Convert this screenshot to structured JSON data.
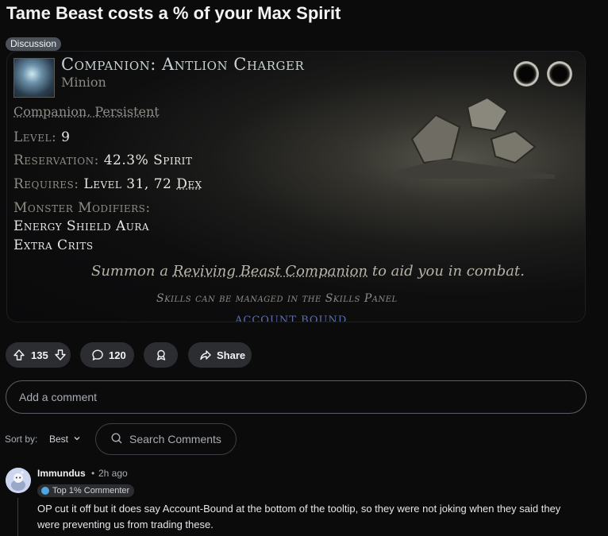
{
  "post": {
    "title": "Tame Beast costs a % of your Max Spirit",
    "flair": "Discussion"
  },
  "tooltip": {
    "name": "Companion: Antlion Charger",
    "type": "Minion",
    "tags": "Companion, Persistent",
    "level_label": "Level:",
    "level_value": "9",
    "reservation_label": "Reservation:",
    "reservation_value": "42.3% Spirit",
    "requires_label": "Requires:",
    "requires_value": "Level 31, 72",
    "requires_attr": "Dex",
    "modifiers_label": "Monster Modifiers:",
    "modifier_1": "Energy Shield Aura",
    "modifier_2": "Extra Crits",
    "desc_1": "Summon a",
    "desc_2": "Reviving Beast Companion",
    "desc_3": "to aid you in combat.",
    "skills_note": "Skills can be managed in the Skills Panel",
    "account_bound_partial": "ACCOUNT BOUND"
  },
  "actions": {
    "upvotes": "135",
    "comments": "120",
    "share_label": "Share"
  },
  "comment_box": {
    "placeholder": "Add a comment"
  },
  "sort": {
    "label": "Sort by:",
    "value": "Best"
  },
  "search": {
    "placeholder": "Search Comments"
  },
  "comments": [
    {
      "author": "Immundus",
      "separator": "•",
      "time": "2h ago",
      "flair": "Top 1% Commenter",
      "body": "OP cut it off but it does say Account-Bound at the bottom of the tooltip, so they were not joking when they said they were preventing us from trading these."
    }
  ],
  "colors": {
    "background": "#0b0b0c",
    "pill": "#2b2d31",
    "text": "#f2f3f5",
    "muted": "#a7acb3",
    "flair_icon": "#4fa6e0"
  },
  "icons": [
    "upvote-icon",
    "downvote-icon",
    "comment-icon",
    "award-icon",
    "share-icon",
    "chevron-down-icon",
    "search-icon",
    "avatar-icon",
    "flair-icon"
  ]
}
